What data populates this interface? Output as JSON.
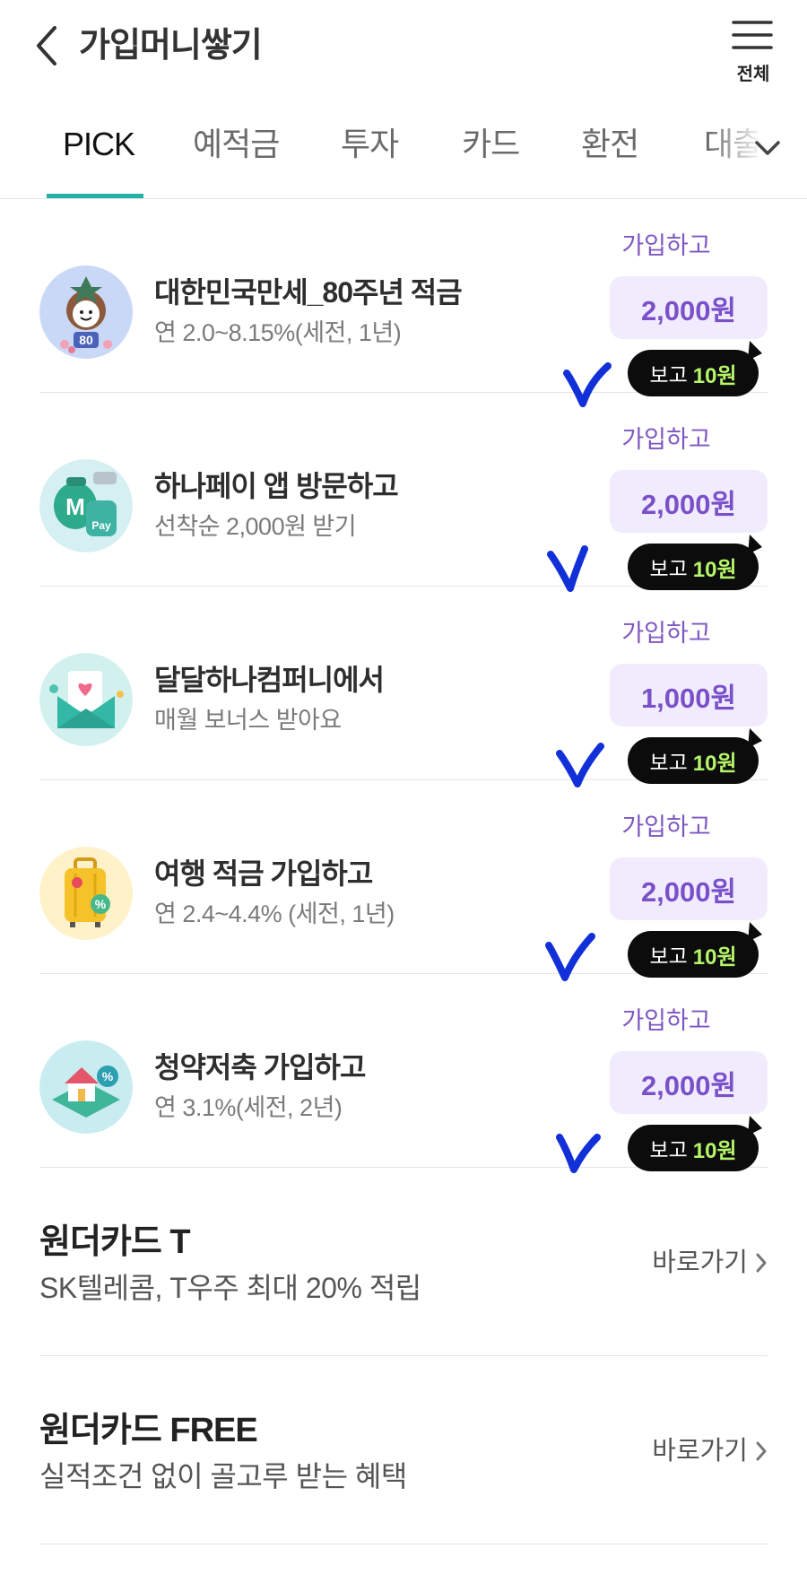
{
  "header": {
    "title": "가입머니쌓기",
    "menu_label": "전체"
  },
  "tabs": [
    {
      "label": "PICK",
      "active": true
    },
    {
      "label": "예적금",
      "active": false
    },
    {
      "label": "투자",
      "active": false
    },
    {
      "label": "카드",
      "active": false
    },
    {
      "label": "환전",
      "active": false
    },
    {
      "label": "대출",
      "active": false
    }
  ],
  "items": [
    {
      "title": "대한민국만세_80주년 적금",
      "subtitle": "연 2.0~8.15%(세전, 1년)",
      "join_label": "가입하고",
      "amount": "2,000원",
      "watch_prefix": "보고",
      "watch_amount": "10원",
      "icon": "anniversary-mascot-icon"
    },
    {
      "title": "하나페이 앱 방문하고",
      "subtitle": "선착순 2,000원 받기",
      "join_label": "가입하고",
      "amount": "2,000원",
      "watch_prefix": "보고",
      "watch_amount": "10원",
      "icon": "hana-pay-icon"
    },
    {
      "title": "달달하나컴퍼니에서",
      "subtitle": "매월 보너스 받아요",
      "join_label": "가입하고",
      "amount": "1,000원",
      "watch_prefix": "보고",
      "watch_amount": "10원",
      "icon": "envelope-heart-icon"
    },
    {
      "title": "여행 적금 가입하고",
      "subtitle": "연 2.4~4.4% (세전, 1년)",
      "join_label": "가입하고",
      "amount": "2,000원",
      "watch_prefix": "보고",
      "watch_amount": "10원",
      "icon": "suitcase-icon"
    },
    {
      "title": "청약저축 가입하고",
      "subtitle": "연 3.1%(세전, 2년)",
      "join_label": "가입하고",
      "amount": "2,000원",
      "watch_prefix": "보고",
      "watch_amount": "10원",
      "icon": "house-percent-icon"
    }
  ],
  "cards": [
    {
      "title": "원더카드 T",
      "subtitle": "SK텔레콤, T우주 최대 20% 적립",
      "link_label": "바로가기"
    },
    {
      "title": "원더카드 FREE",
      "subtitle": "실적조건 없이 골고루 받는 혜택",
      "link_label": "바로가기"
    }
  ],
  "colors": {
    "accent_teal": "#22b3a6",
    "purple_text": "#7a50c9",
    "purple_bg": "#f1ecfd",
    "badge_bg": "#0c0c0c",
    "badge_green": "#b5f56a",
    "check_blue": "#1230d8"
  }
}
